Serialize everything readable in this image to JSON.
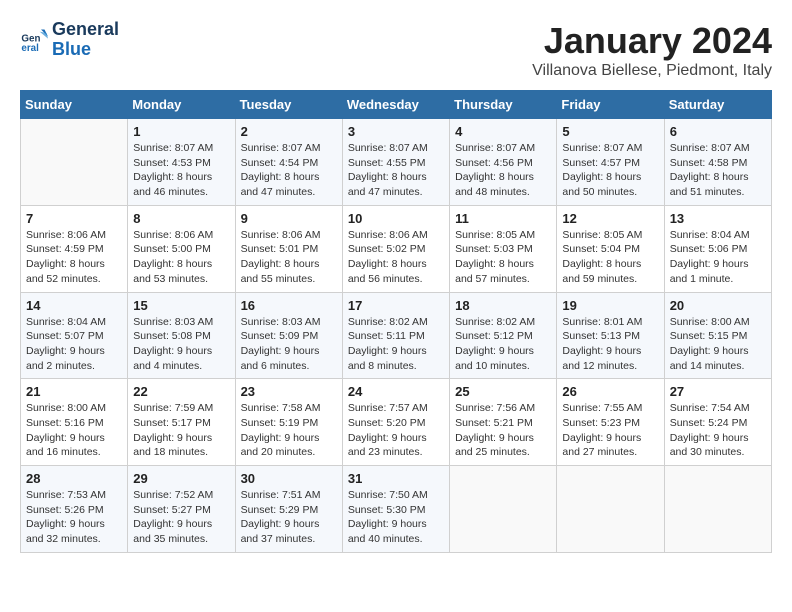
{
  "logo": {
    "line1": "General",
    "line2": "Blue"
  },
  "title": "January 2024",
  "subtitle": "Villanova Biellese, Piedmont, Italy",
  "days_of_week": [
    "Sunday",
    "Monday",
    "Tuesday",
    "Wednesday",
    "Thursday",
    "Friday",
    "Saturday"
  ],
  "weeks": [
    [
      {
        "day": "",
        "info": ""
      },
      {
        "day": "1",
        "info": "Sunrise: 8:07 AM\nSunset: 4:53 PM\nDaylight: 8 hours\nand 46 minutes."
      },
      {
        "day": "2",
        "info": "Sunrise: 8:07 AM\nSunset: 4:54 PM\nDaylight: 8 hours\nand 47 minutes."
      },
      {
        "day": "3",
        "info": "Sunrise: 8:07 AM\nSunset: 4:55 PM\nDaylight: 8 hours\nand 47 minutes."
      },
      {
        "day": "4",
        "info": "Sunrise: 8:07 AM\nSunset: 4:56 PM\nDaylight: 8 hours\nand 48 minutes."
      },
      {
        "day": "5",
        "info": "Sunrise: 8:07 AM\nSunset: 4:57 PM\nDaylight: 8 hours\nand 50 minutes."
      },
      {
        "day": "6",
        "info": "Sunrise: 8:07 AM\nSunset: 4:58 PM\nDaylight: 8 hours\nand 51 minutes."
      }
    ],
    [
      {
        "day": "7",
        "info": "Sunrise: 8:06 AM\nSunset: 4:59 PM\nDaylight: 8 hours\nand 52 minutes."
      },
      {
        "day": "8",
        "info": "Sunrise: 8:06 AM\nSunset: 5:00 PM\nDaylight: 8 hours\nand 53 minutes."
      },
      {
        "day": "9",
        "info": "Sunrise: 8:06 AM\nSunset: 5:01 PM\nDaylight: 8 hours\nand 55 minutes."
      },
      {
        "day": "10",
        "info": "Sunrise: 8:06 AM\nSunset: 5:02 PM\nDaylight: 8 hours\nand 56 minutes."
      },
      {
        "day": "11",
        "info": "Sunrise: 8:05 AM\nSunset: 5:03 PM\nDaylight: 8 hours\nand 57 minutes."
      },
      {
        "day": "12",
        "info": "Sunrise: 8:05 AM\nSunset: 5:04 PM\nDaylight: 8 hours\nand 59 minutes."
      },
      {
        "day": "13",
        "info": "Sunrise: 8:04 AM\nSunset: 5:06 PM\nDaylight: 9 hours\nand 1 minute."
      }
    ],
    [
      {
        "day": "14",
        "info": "Sunrise: 8:04 AM\nSunset: 5:07 PM\nDaylight: 9 hours\nand 2 minutes."
      },
      {
        "day": "15",
        "info": "Sunrise: 8:03 AM\nSunset: 5:08 PM\nDaylight: 9 hours\nand 4 minutes."
      },
      {
        "day": "16",
        "info": "Sunrise: 8:03 AM\nSunset: 5:09 PM\nDaylight: 9 hours\nand 6 minutes."
      },
      {
        "day": "17",
        "info": "Sunrise: 8:02 AM\nSunset: 5:11 PM\nDaylight: 9 hours\nand 8 minutes."
      },
      {
        "day": "18",
        "info": "Sunrise: 8:02 AM\nSunset: 5:12 PM\nDaylight: 9 hours\nand 10 minutes."
      },
      {
        "day": "19",
        "info": "Sunrise: 8:01 AM\nSunset: 5:13 PM\nDaylight: 9 hours\nand 12 minutes."
      },
      {
        "day": "20",
        "info": "Sunrise: 8:00 AM\nSunset: 5:15 PM\nDaylight: 9 hours\nand 14 minutes."
      }
    ],
    [
      {
        "day": "21",
        "info": "Sunrise: 8:00 AM\nSunset: 5:16 PM\nDaylight: 9 hours\nand 16 minutes."
      },
      {
        "day": "22",
        "info": "Sunrise: 7:59 AM\nSunset: 5:17 PM\nDaylight: 9 hours\nand 18 minutes."
      },
      {
        "day": "23",
        "info": "Sunrise: 7:58 AM\nSunset: 5:19 PM\nDaylight: 9 hours\nand 20 minutes."
      },
      {
        "day": "24",
        "info": "Sunrise: 7:57 AM\nSunset: 5:20 PM\nDaylight: 9 hours\nand 23 minutes."
      },
      {
        "day": "25",
        "info": "Sunrise: 7:56 AM\nSunset: 5:21 PM\nDaylight: 9 hours\nand 25 minutes."
      },
      {
        "day": "26",
        "info": "Sunrise: 7:55 AM\nSunset: 5:23 PM\nDaylight: 9 hours\nand 27 minutes."
      },
      {
        "day": "27",
        "info": "Sunrise: 7:54 AM\nSunset: 5:24 PM\nDaylight: 9 hours\nand 30 minutes."
      }
    ],
    [
      {
        "day": "28",
        "info": "Sunrise: 7:53 AM\nSunset: 5:26 PM\nDaylight: 9 hours\nand 32 minutes."
      },
      {
        "day": "29",
        "info": "Sunrise: 7:52 AM\nSunset: 5:27 PM\nDaylight: 9 hours\nand 35 minutes."
      },
      {
        "day": "30",
        "info": "Sunrise: 7:51 AM\nSunset: 5:29 PM\nDaylight: 9 hours\nand 37 minutes."
      },
      {
        "day": "31",
        "info": "Sunrise: 7:50 AM\nSunset: 5:30 PM\nDaylight: 9 hours\nand 40 minutes."
      },
      {
        "day": "",
        "info": ""
      },
      {
        "day": "",
        "info": ""
      },
      {
        "day": "",
        "info": ""
      }
    ]
  ]
}
